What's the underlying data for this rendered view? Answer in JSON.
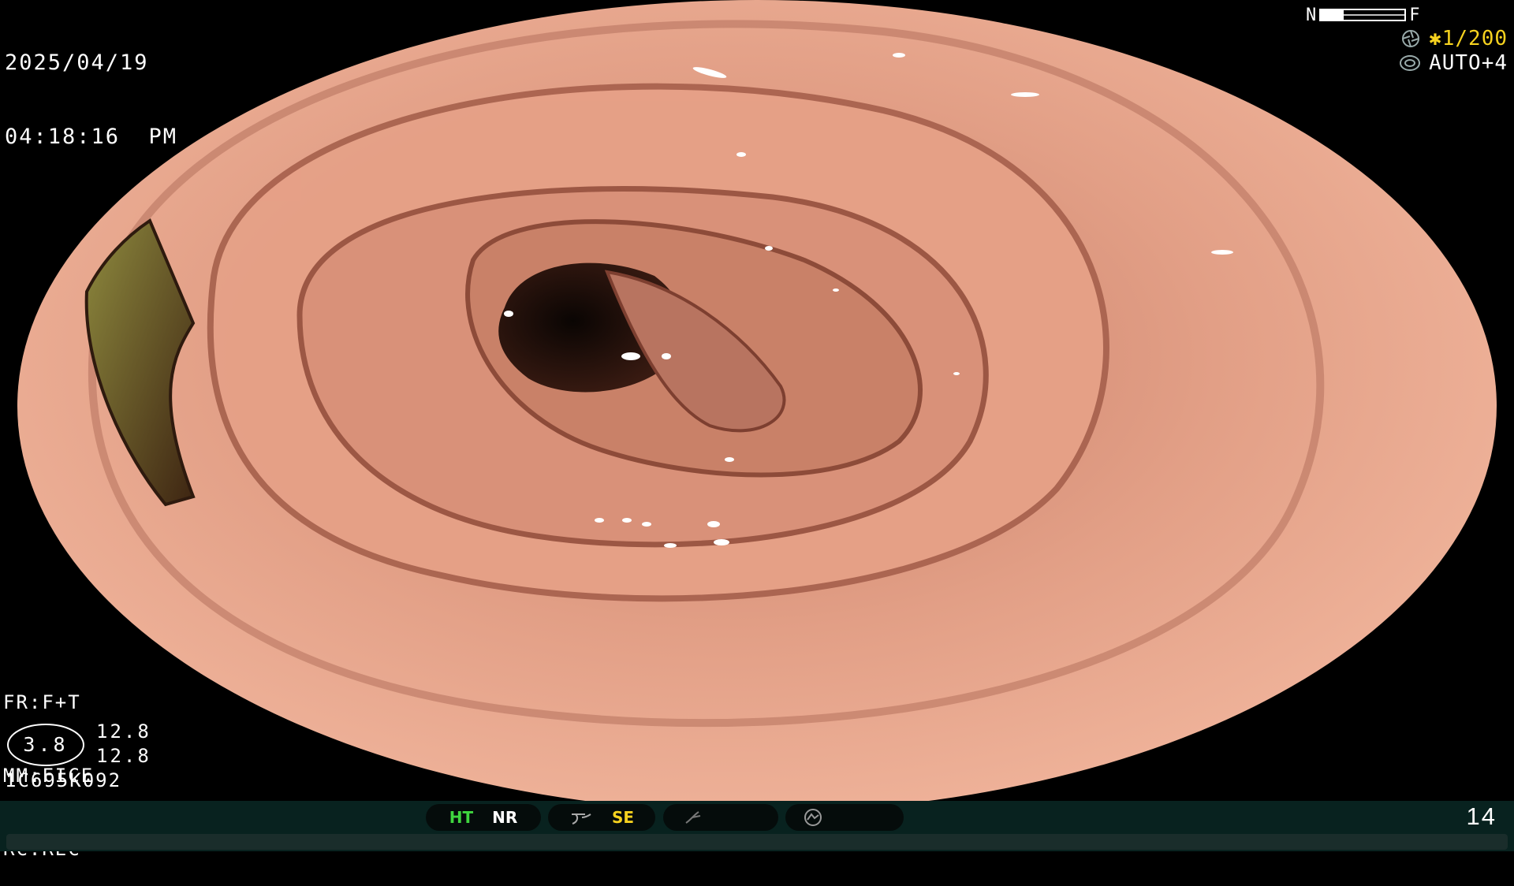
{
  "osd": {
    "date": "2025/04/19",
    "time": "04:18:16  PM",
    "fr": "FR:F+T",
    "mm": "MM:FICE",
    "rc": "RC:REC",
    "circle_value": "3.8",
    "pair_top": "12.8",
    "pair_bottom": "12.8",
    "serial": "1C695K092",
    "near_label": "N",
    "far_label": "F",
    "shutter_speed": "✱1/200",
    "auto_exposure": "AUTO+4"
  },
  "status_bar": {
    "ht": "HT",
    "nr": "NR",
    "se": "SE",
    "frame_count": "14"
  },
  "icons": [
    "shutter-icon",
    "auto-iris-icon",
    "freeze-curve-icon",
    "lightning-icon",
    "pump-icon"
  ],
  "colors": {
    "mucosa": "#e8a58a",
    "lumen": "#1a0c07",
    "status_bg": "#08221f",
    "ht_green": "#3fd63f",
    "se_yellow": "#f6d21f"
  }
}
